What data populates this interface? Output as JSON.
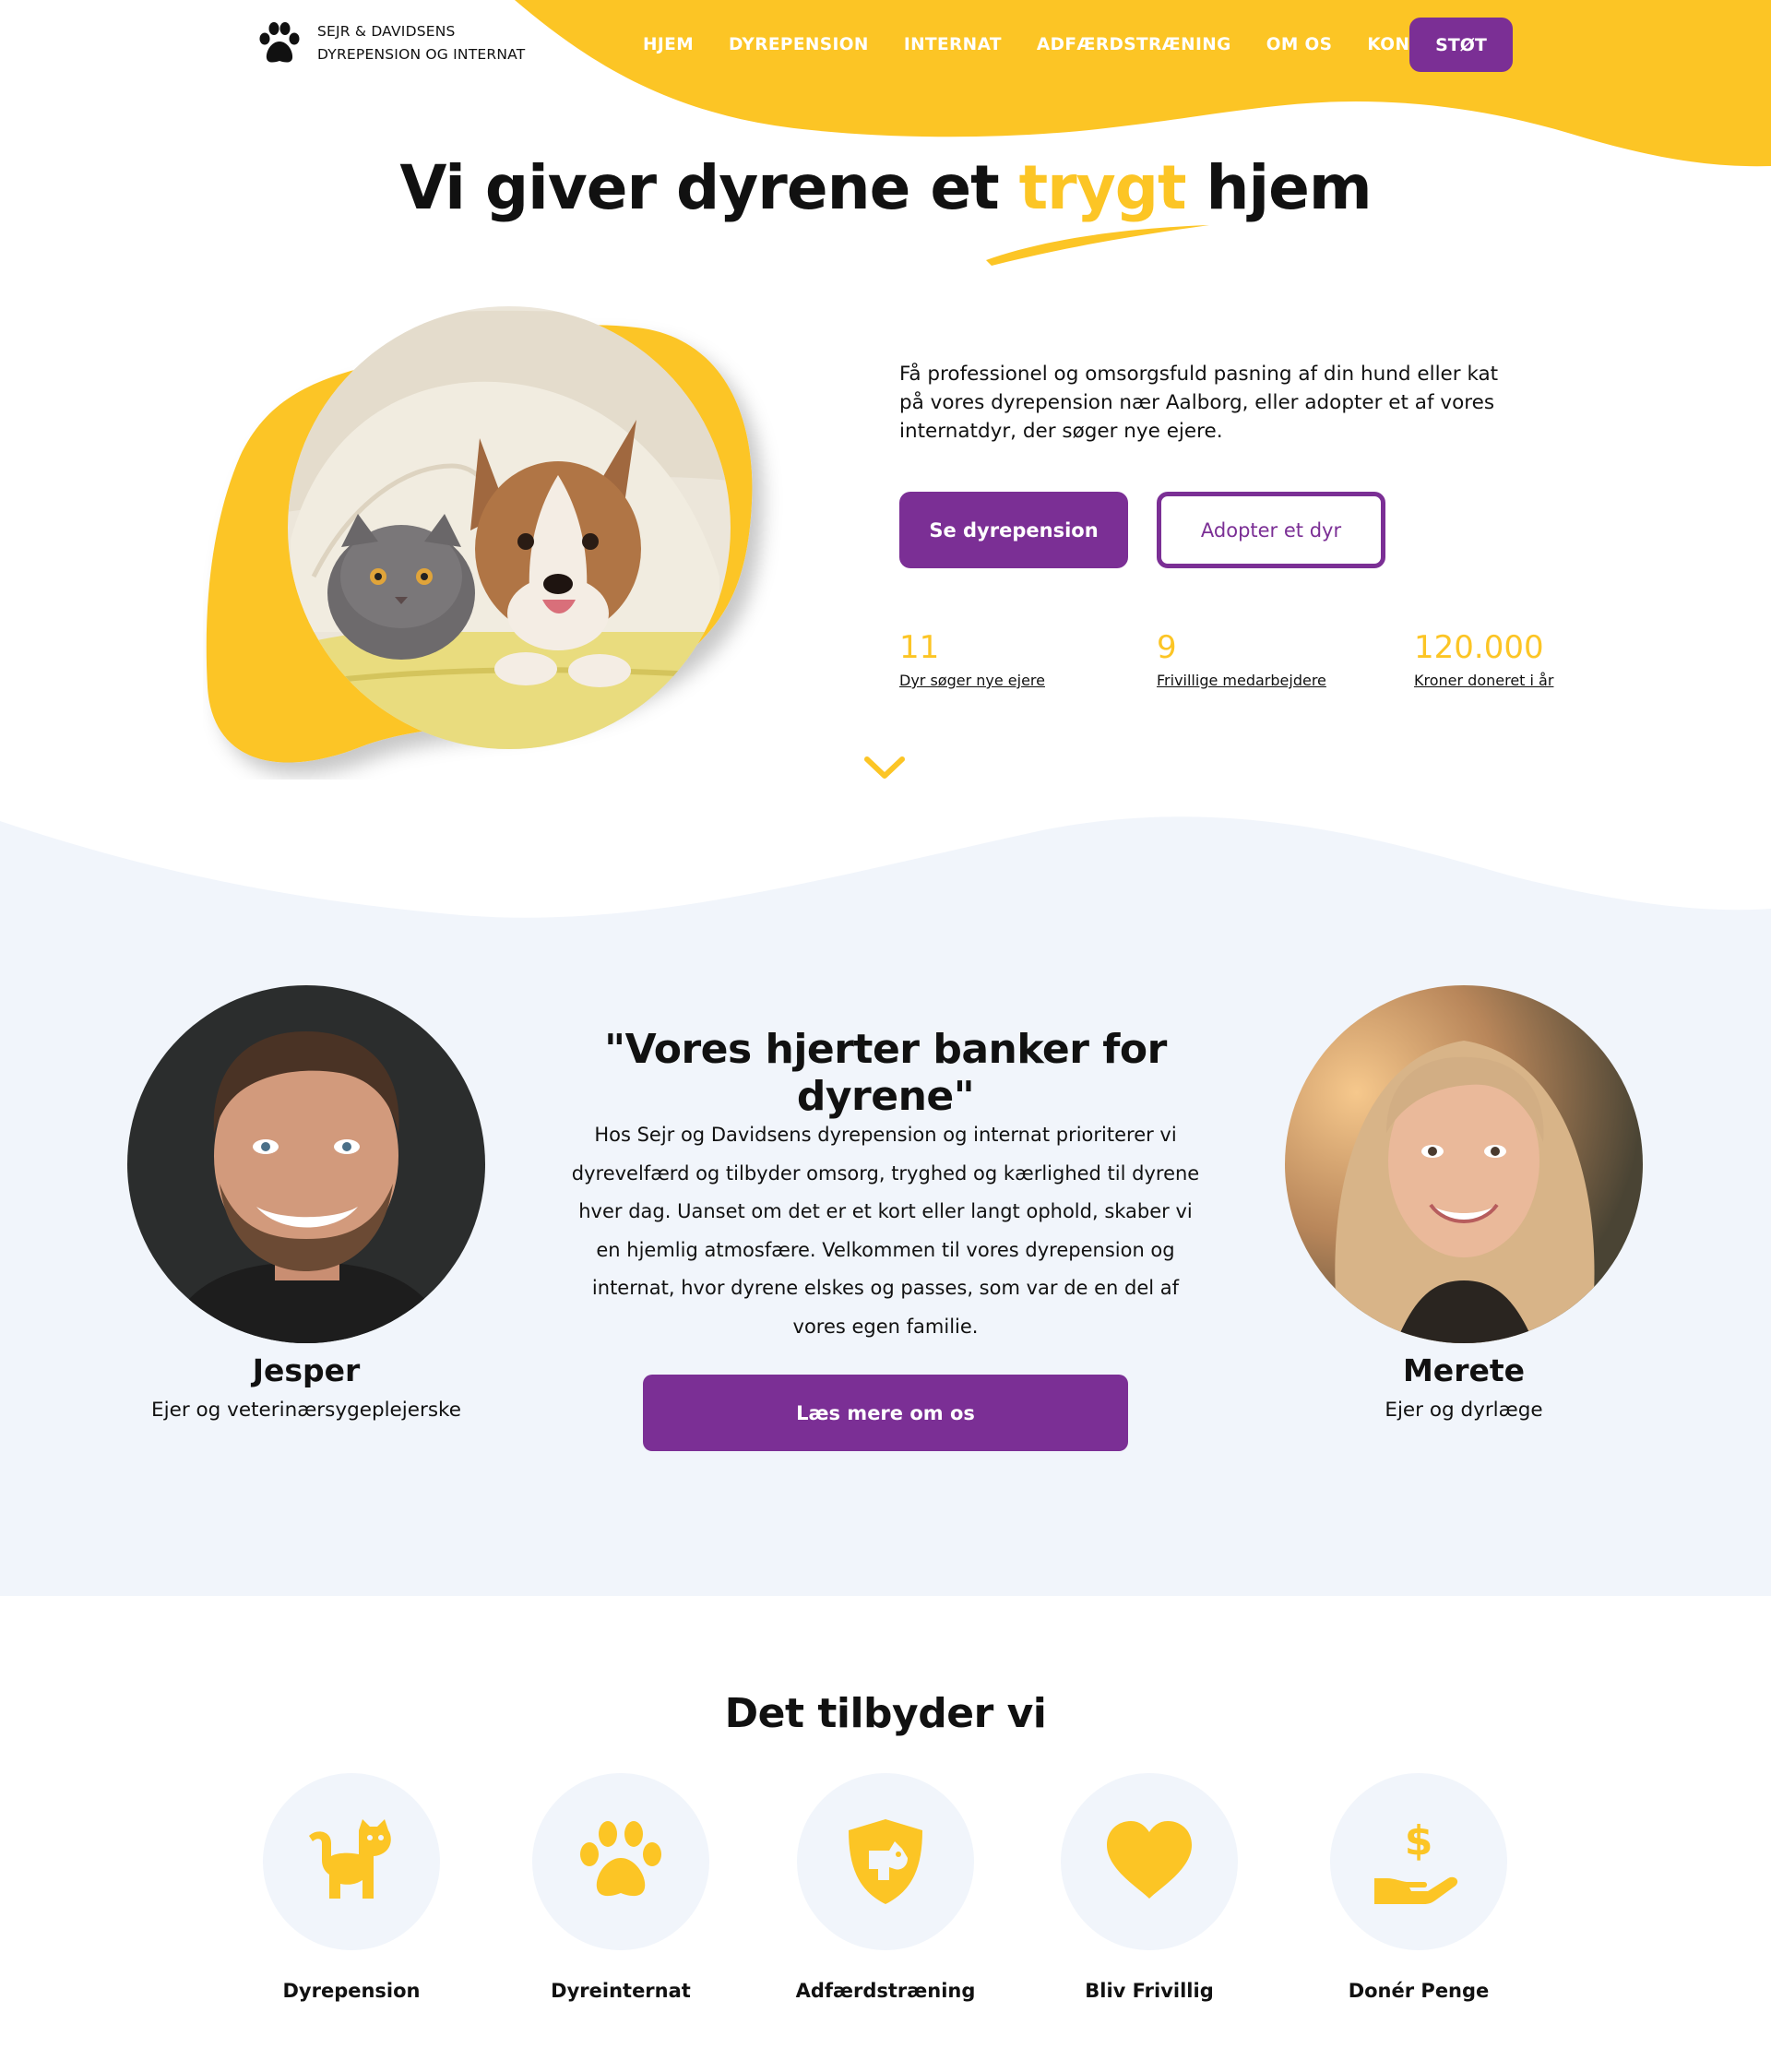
{
  "colors": {
    "accent": "#fcc525",
    "brand_purple": "#7b2f95",
    "light_bg": "#f1f5fb"
  },
  "header": {
    "logo_icon": "paw-icon",
    "logo_line1": "SEJR & DAVIDSENS",
    "logo_line2": "DYREPENSION OG INTERNAT",
    "nav": [
      "HJEM",
      "DYREPENSION",
      "INTERNAT",
      "ADFÆRDSTRÆNING",
      "OM OS",
      "KONTAKT"
    ],
    "support_label": "STØT"
  },
  "hero": {
    "title_before": "Vi giver dyrene et",
    "title_accent": "trygt",
    "title_after": "hjem",
    "image": "cat-and-corgi-under-blanket",
    "text": "Få professionel og omsorgsfuld pasning af din hund eller kat på vores dyrepension nær Aalborg, eller adopter et af vores internatdyr, der søger nye ejere.",
    "primary_button": "Se dyrepension",
    "secondary_button": "Adopter et dyr",
    "stats": [
      {
        "value": "11",
        "label": "Dyr søger nye ejere"
      },
      {
        "value": "9",
        "label": "Frivillige medarbejdere"
      },
      {
        "value": "120.000",
        "label": "Kroner doneret i år"
      }
    ],
    "scroll_icon": "chevron-down-icon"
  },
  "about": {
    "quote": "\"Vores hjerter banker for dyrene\"",
    "text": "Hos Sejr og Davidsens dyrepension og internat prioriterer vi dyrevelfærd og tilbyder omsorg, tryghed og kærlighed til dyrene hver dag. Uanset om det er et kort eller langt ophold, skaber vi en hjemlig atmosfære. Velkommen til vores dyrepension og internat, hvor dyrene elskes og passes, som var de en del af vores egen familie.",
    "button": "Læs mere om os",
    "people": [
      {
        "name": "Jesper",
        "role": "Ejer og veterinærsygeplejerske"
      },
      {
        "name": "Merete",
        "role": "Ejer og dyrlæge"
      }
    ]
  },
  "services": {
    "title": "Det tilbyder vi",
    "items": [
      {
        "label": "Dyrepension",
        "icon": "cat-icon"
      },
      {
        "label": "Dyreinternat",
        "icon": "paw-icon"
      },
      {
        "label": "Adfærdstræning",
        "icon": "dog-shield-icon"
      },
      {
        "label": "Bliv Frivillig",
        "icon": "heart-icon"
      },
      {
        "label": "Donér Penge",
        "icon": "hand-dollar-icon"
      }
    ]
  }
}
